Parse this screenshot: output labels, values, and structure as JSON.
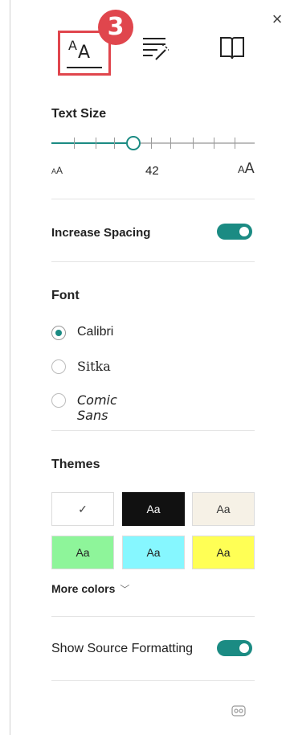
{
  "header": {
    "close_glyph": "×",
    "tabs": [
      {
        "name": "text-options",
        "icon": "text-size-icon"
      },
      {
        "name": "grammar-options",
        "icon": "grammar-options-icon"
      },
      {
        "name": "reading-preferences",
        "icon": "book-icon"
      }
    ],
    "badge": "3"
  },
  "text_size": {
    "label": "Text Size",
    "small_glyph": "AA",
    "large_glyph": "AA",
    "value": "42",
    "level": 0.4
  },
  "spacing": {
    "label": "Increase Spacing",
    "on": true
  },
  "font": {
    "label": "Font",
    "options": [
      {
        "label": "Calibri",
        "selected": true
      },
      {
        "label": "Sitka",
        "selected": false
      },
      {
        "label": "Comic Sans",
        "selected": false
      }
    ]
  },
  "themes": {
    "label": "Themes",
    "swatches": [
      {
        "text": "✓",
        "bg": "#ffffff",
        "fg": "#444444",
        "selected": true
      },
      {
        "text": "Aa",
        "bg": "#111111",
        "fg": "#ffffff",
        "selected": false
      },
      {
        "text": "Aa",
        "bg": "#f6f1e6",
        "fg": "#333333",
        "selected": false
      },
      {
        "text": "Aa",
        "bg": "#8ef59a",
        "fg": "#222222",
        "selected": false
      },
      {
        "text": "Aa",
        "bg": "#86f7ff",
        "fg": "#222222",
        "selected": false
      },
      {
        "text": "Aa",
        "bg": "#ffff55",
        "fg": "#222222",
        "selected": false
      }
    ],
    "more_colors": "More colors",
    "more_chevron": "﹀"
  },
  "source_formatting": {
    "label": "Show Source Formatting",
    "on": true
  },
  "colors": {
    "accent": "#1b8b83",
    "highlight": "#e0464d"
  }
}
